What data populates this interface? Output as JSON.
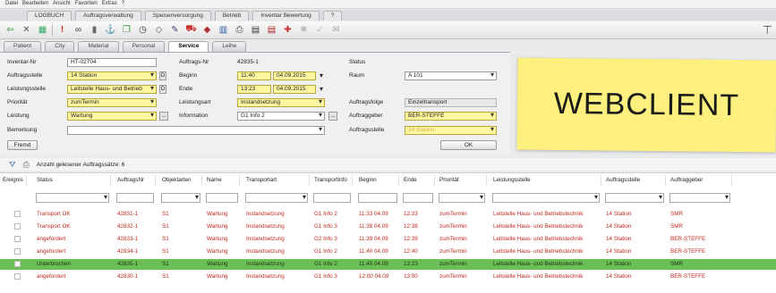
{
  "menu": [
    "Datei",
    "Bearbeiten",
    "Ansicht",
    "Favoriten",
    "Extras",
    "?"
  ],
  "nav": [
    "LOGBUCH",
    "Auftragsverwaltung",
    "Speisenversorgung",
    "Betrieb",
    "Inventar Bewertung",
    "?"
  ],
  "toolbar_icons": [
    "exit-icon",
    "delete-icon",
    "calculator-icon",
    "alert-icon",
    "binoculars-icon",
    "bottle-icon",
    "anchor-icon",
    "copy-icon",
    "clock-icon",
    "diamond-icon",
    "pen-icon",
    "truck-icon",
    "bag-icon",
    "book-icon",
    "print-icon",
    "film-icon",
    "film2-icon",
    "plus-icon",
    "inactive-icon",
    "inactive2-icon",
    "mail-icon"
  ],
  "tabs": [
    "Patient",
    "City",
    "Material",
    "Personal",
    "Service",
    "Leihe"
  ],
  "form": {
    "inventar_label": "Inventar-Nr",
    "inventar_value": "HT-02704",
    "auftragsnr_label": "Auftrags-Nr",
    "auftragsnr_value": "42835-1",
    "status_label": "Status",
    "auftragsstelle_label": "Auftragsstelle",
    "auftragsstelle_value": "14 Station",
    "d1": "D",
    "beginn_label": "Beginn",
    "beginn_time": "11:40",
    "beginn_date": "04.09.2015",
    "raum_label": "Raum",
    "raum_value": "A 101",
    "leistungsstelle_label": "Leistungsstelle",
    "leistungsstelle_value": "Leitstelle Haus- und Betrieb",
    "d2": "D",
    "ende_label": "Ende",
    "ende_time": "13:23",
    "ende_date": "04.09.2015",
    "prioritaet_label": "Priorität",
    "prioritaet_value": "zumTermin",
    "leistungsart_label": "Leistungsart",
    "leistungsart_value": "Instandsetzung",
    "auftragsfolge_label": "Auftragsfolge",
    "auftragsfolge_value": "Einzeltransport",
    "leistung_label": "Leistung",
    "leistung_value": "Wartung",
    "dots": "...",
    "information_label": "Information",
    "information_value": "G1 Info 2",
    "auftraggeber_label": "Auftraggeber",
    "auftraggeber_value": "BER-STEFFE",
    "bemerkung_label": "Bemerkung",
    "auftragsstelle2_label": "Auftragsstelle",
    "auftragsstelle2_value": "14 Station",
    "fremd_btn": "Fremd",
    "ok_btn": "OK"
  },
  "note_text": "WEBCLIENT",
  "count_text": "Anzahl gelesener Auftragssätze: 6",
  "columns": [
    "Ereignis",
    "Status",
    "AuftragsNr",
    "Objektarten",
    "Name",
    "Transportart",
    "Transportinfo",
    "Beginn",
    "Ende",
    "Priorität",
    "Leistungsstelle",
    "Auftragsstelle",
    "Auftraggeber"
  ],
  "rows": [
    [
      "",
      "Transport OK",
      "42831-1",
      "S1",
      "Wartung",
      "Instandsetzung",
      "G1 Info 2",
      "11:33 04.09",
      "12:33",
      "zumTermin",
      "Leitstelle Haus- und Betriebstechnik",
      "14 Station",
      "SMR"
    ],
    [
      "",
      "Transport OK",
      "42832-1",
      "S1",
      "Wartung",
      "Instandsetzung",
      "G1 Info 3",
      "11:38 04.09",
      "12:38",
      "zumTermin",
      "Leitstelle Haus- und Betriebstechnik",
      "14 Station",
      "SMR"
    ],
    [
      "",
      "angefordert",
      "42833-1",
      "S1",
      "Wartung",
      "Instandsetzung",
      "G2 Info 3",
      "11:39 04.09",
      "12:39",
      "zumTermin",
      "Leitstelle Haus- und Betriebstechnik",
      "14 Station",
      "BER-STEFFE"
    ],
    [
      "",
      "angefordert",
      "42834-1",
      "S1",
      "Wartung",
      "Instandsetzung",
      "G1 Info 2",
      "11:40 04.09",
      "12:40",
      "zumTermin",
      "Leitstelle Haus- und Betriebstechnik",
      "14 Station",
      "BER-STEFFE"
    ],
    [
      "",
      "Unterbrochen",
      "42835-1",
      "S1",
      "Wartung",
      "Instandsetzung",
      "G1 Info 2",
      "11:45 04.09",
      "13:23",
      "zumTermin",
      "Leitstelle Haus- und Betriebstechnik",
      "14 Station",
      "SMR"
    ],
    [
      "",
      "angefordert",
      "42830-1",
      "S1",
      "Wartung",
      "Instandsetzung",
      "G1 Info 3",
      "12:00 04.09",
      "13:00",
      "zumTermin",
      "Leitstelle Haus- und Betriebstechnik",
      "14 Station",
      "BER-STEFFE"
    ]
  ],
  "colors": {
    "accent_yellow": "#fff7a0",
    "row_red": "#c0281d",
    "selected_green": "#6bbf57",
    "note_yellow": "#fdf07e"
  }
}
